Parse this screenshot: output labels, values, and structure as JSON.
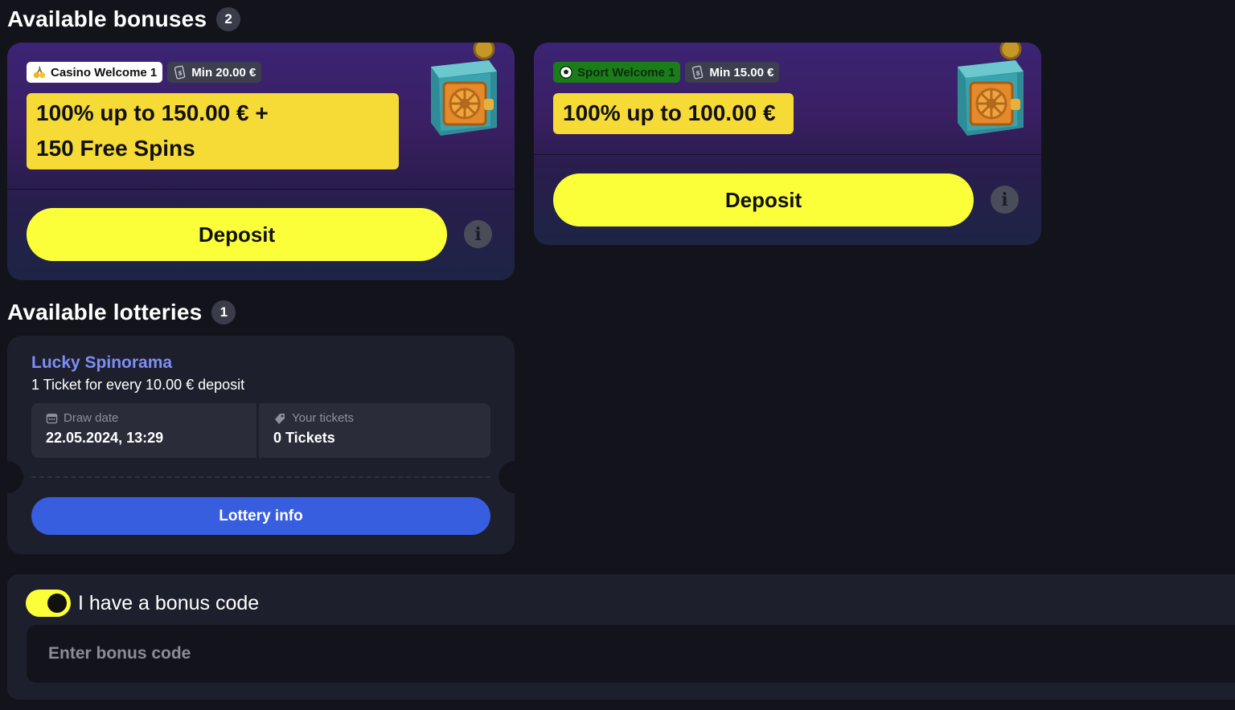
{
  "bonuses_section": {
    "title": "Available bonuses",
    "count": "2"
  },
  "bonuses": [
    {
      "tag": "Casino Welcome 1",
      "tag_icon": "cherries-icon",
      "min": "Min 20.00 €",
      "offer_line1": "100% up to 150.00 € +",
      "offer_line2": "150 Free Spins",
      "button": "Deposit",
      "info": "i"
    },
    {
      "tag": "Sport Welcome 1",
      "tag_icon": "soccer-ball-icon",
      "min": "Min 15.00 €",
      "offer_line1": "100% up to 100.00 €",
      "button": "Deposit",
      "info": "i"
    }
  ],
  "lotteries_section": {
    "title": "Available lotteries",
    "count": "1"
  },
  "lottery": {
    "name": "Lucky Spinorama",
    "description": "1 Ticket for every 10.00 € deposit",
    "draw_label": "Draw date",
    "draw_value": "22.05.2024, 13:29",
    "tickets_label": "Your tickets",
    "tickets_value": "0 Tickets",
    "button": "Lottery info"
  },
  "bonus_code": {
    "toggle_label": "I have a bonus code",
    "toggle_on": true,
    "placeholder": "Enter bonus code"
  },
  "colors": {
    "background": "#13141b",
    "card": "#1d1f2c",
    "accent_yellow": "#fbff3a",
    "offer_yellow": "#f6da36",
    "lottery_blue": "#385ee0",
    "lottery_name": "#7e8ef3"
  }
}
